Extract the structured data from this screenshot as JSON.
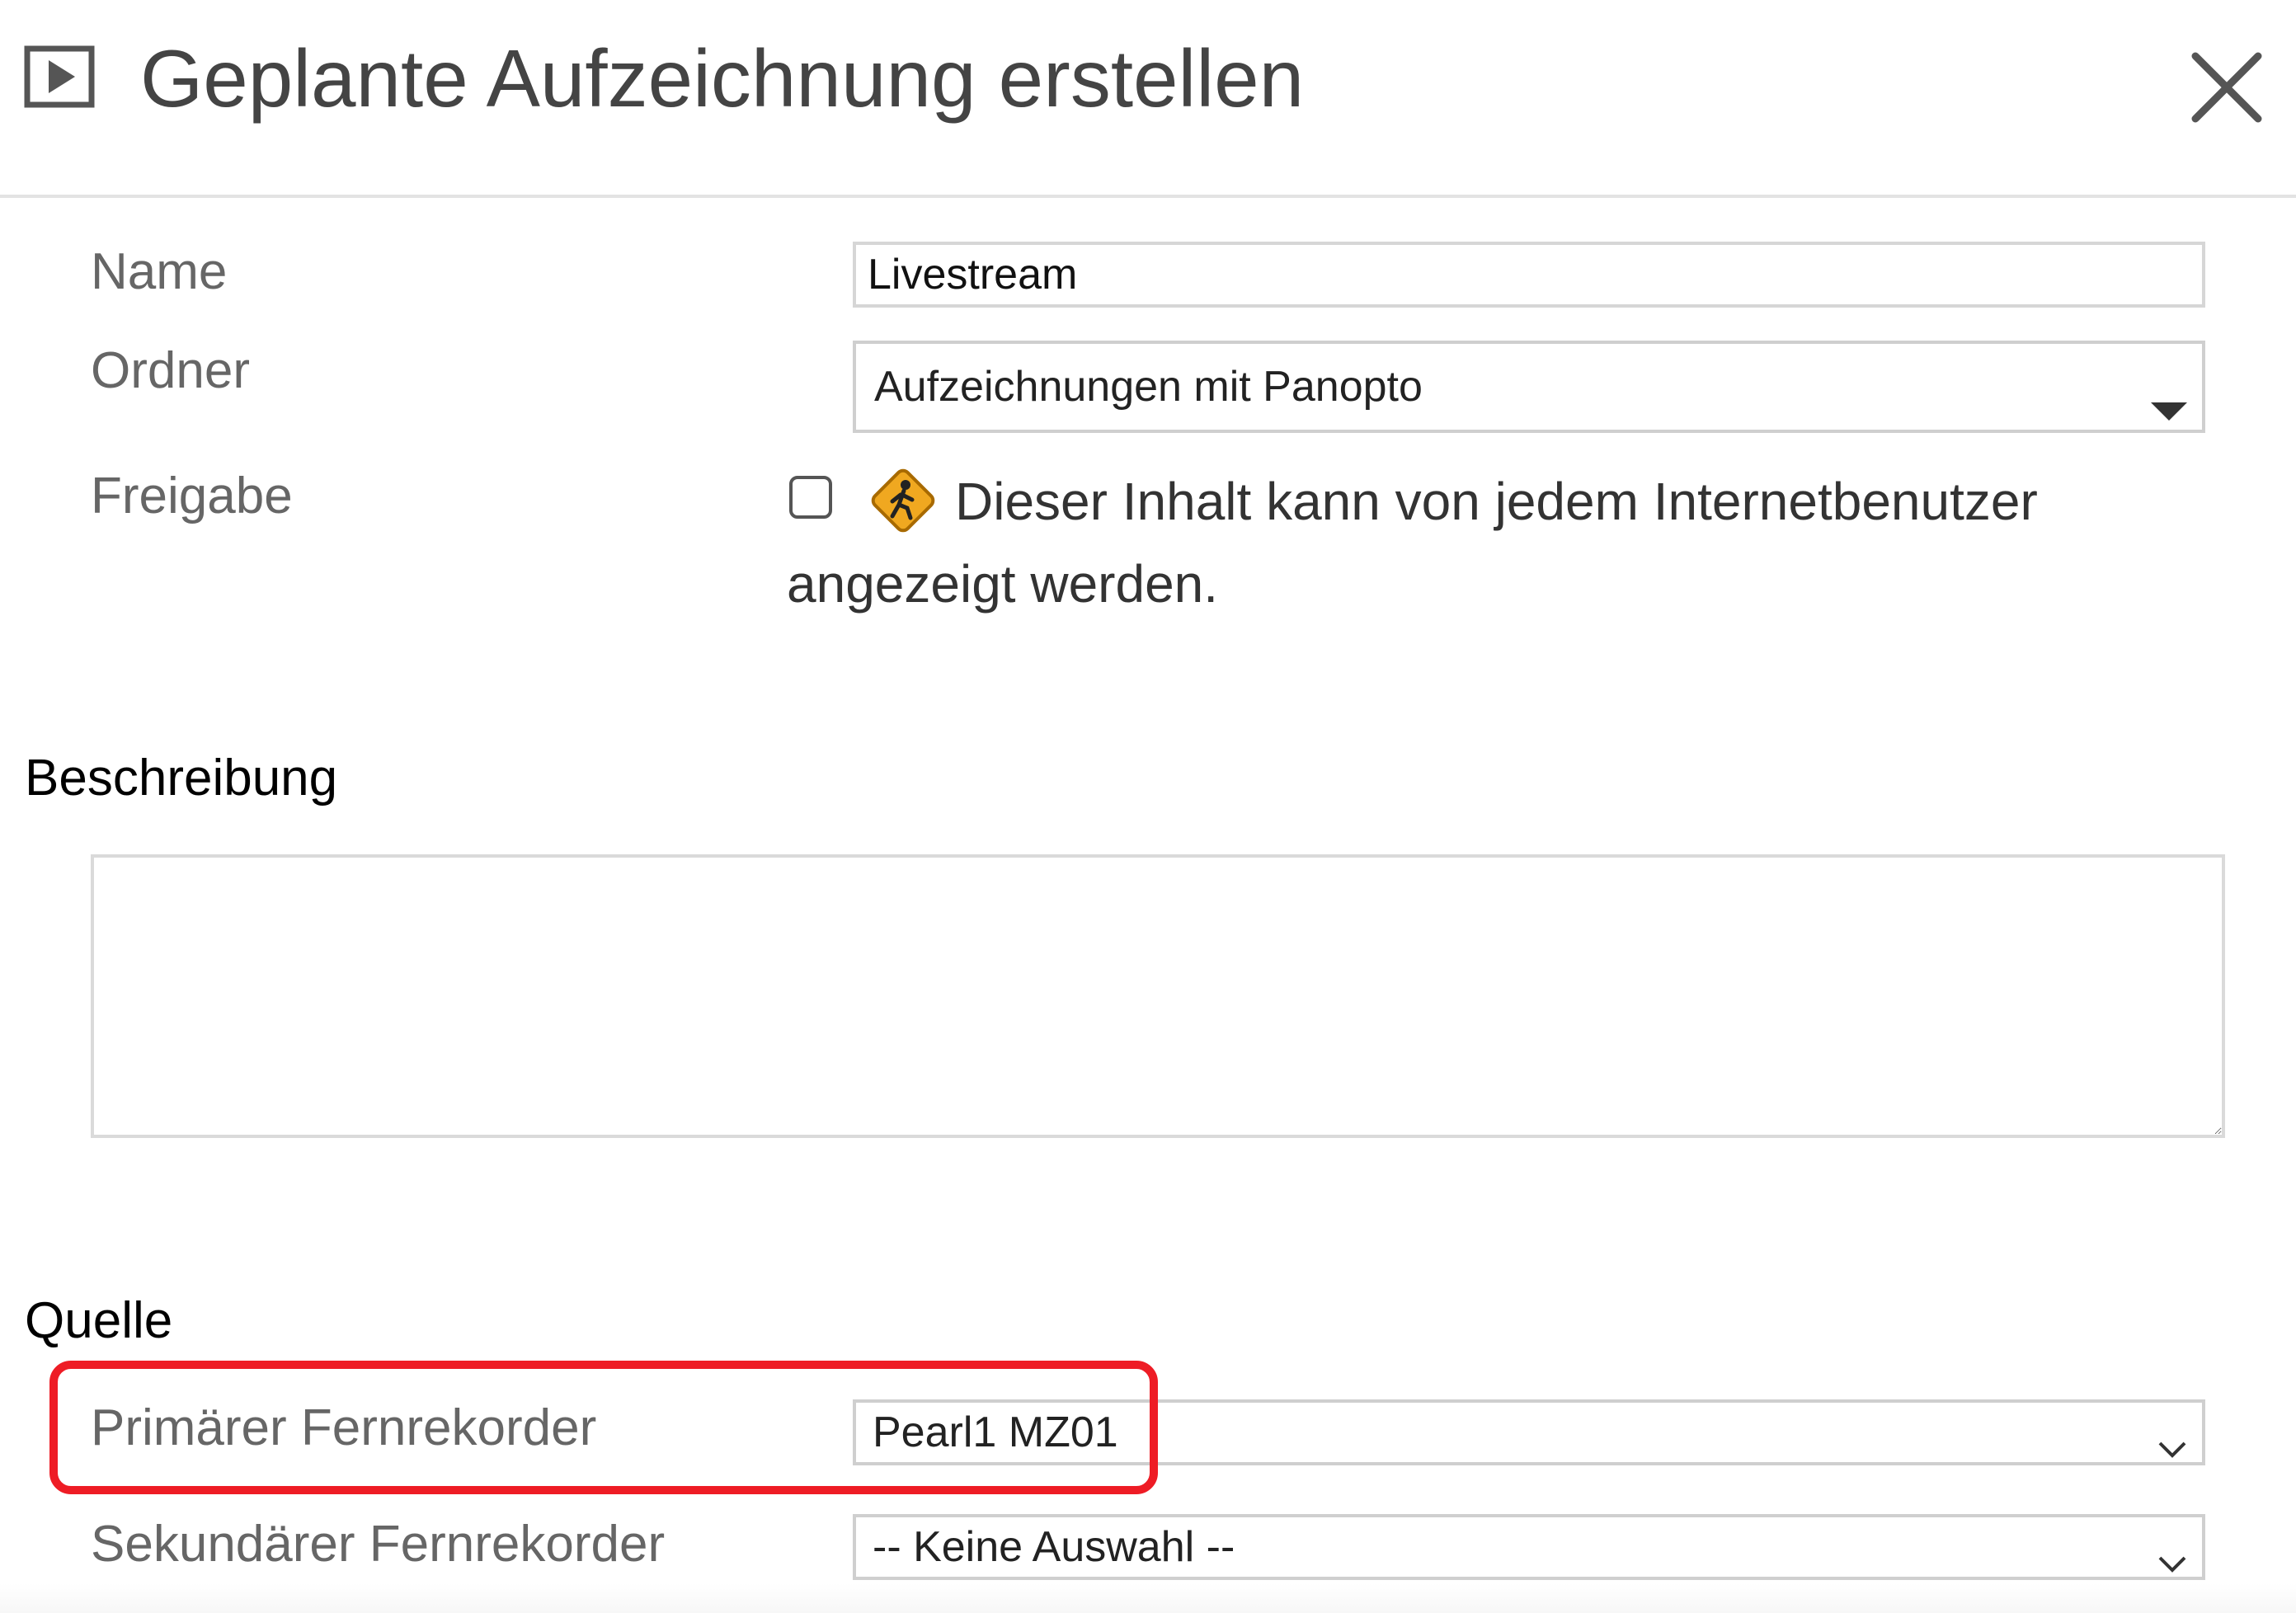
{
  "dialog": {
    "title": "Geplante Aufzeichnung erstellen",
    "header_icon": "play-icon",
    "close_icon": "close-icon"
  },
  "fields": {
    "name": {
      "label": "Name",
      "value": "Livestream"
    },
    "folder": {
      "label": "Ordner",
      "selected": "Aufzeichnungen mit Panopto"
    },
    "sharing": {
      "label": "Freigabe",
      "checked": false,
      "icon": "public-pedestrian-icon",
      "description_line1": "Dieser Inhalt kann von jedem Internetbenutzer",
      "description_line2": "angezeigt werden."
    }
  },
  "description": {
    "heading": "Beschreibung",
    "value": ""
  },
  "source": {
    "heading": "Quelle",
    "primary": {
      "label": "Primärer Fernrekorder",
      "selected": "Pearl1 MZ01"
    },
    "secondary": {
      "label": "Sekundärer Fernrekorder",
      "selected": "-- Keine Auswahl --"
    }
  },
  "colors": {
    "highlight": "#ee1c25",
    "title_text": "#444444",
    "label_text": "#666666",
    "sign_yellow": "#f0a820"
  }
}
